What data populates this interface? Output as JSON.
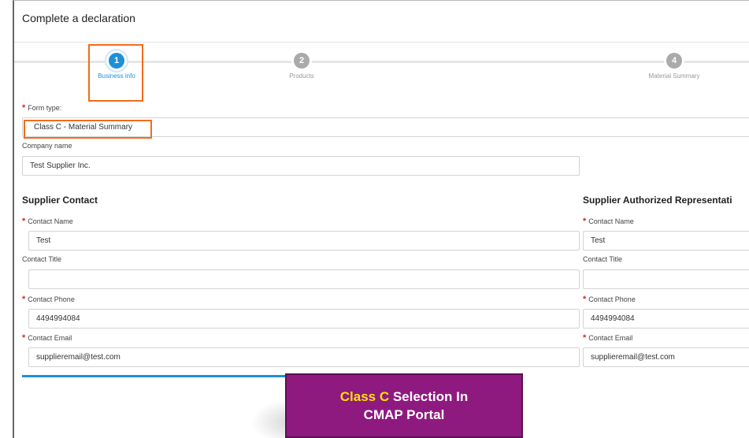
{
  "page": {
    "title": "Complete a declaration"
  },
  "stepper": {
    "steps": [
      {
        "number": "1",
        "label": "Business info",
        "state": "active"
      },
      {
        "number": "2",
        "label": "Products",
        "state": "inactive"
      },
      {
        "number": "4",
        "label": "Material Summary",
        "state": "inactive"
      }
    ]
  },
  "form": {
    "form_type_label": "Form type:",
    "form_type_value": "Class C - Material Summary",
    "company_name_label": "Company name",
    "company_name_value": "Test Supplier Inc."
  },
  "supplier_contact": {
    "heading": "Supplier Contact",
    "contact_name_label": "Contact Name",
    "contact_name_value": "Test",
    "contact_title_label": "Contact Title",
    "contact_title_value": "",
    "contact_phone_label": "Contact Phone",
    "contact_phone_value": "4494994084",
    "contact_email_label": "Contact Email",
    "contact_email_value": "supplieremail@test.com"
  },
  "authorized_rep": {
    "heading": "Supplier Authorized Representati",
    "contact_name_label": "Contact Name",
    "contact_name_value": "Test",
    "contact_title_label": "Contact Title",
    "contact_title_value": "",
    "contact_phone_label": "Contact Phone",
    "contact_phone_value": "4494994084",
    "contact_email_label": "Contact Email",
    "contact_email_value": "supplieremail@test.com"
  },
  "callout": {
    "highlight": "Class C",
    "text_line1": " Selection In",
    "text_line2": "CMAP Portal"
  },
  "colors": {
    "accent": "#1e90d8",
    "highlight_border": "#f36b1c",
    "callout_bg": "#8e1a7f",
    "callout_highlight": "#ffe100",
    "required": "#d12a2a"
  }
}
